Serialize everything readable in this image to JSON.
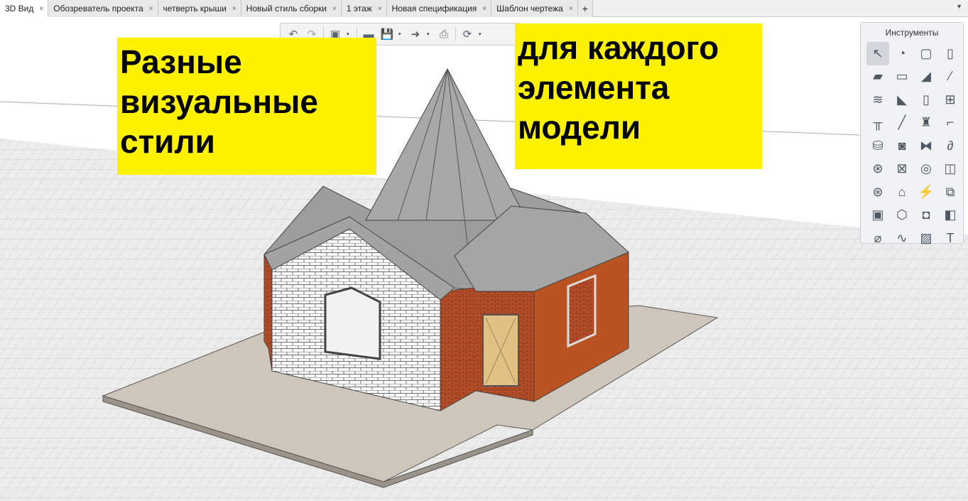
{
  "tabs": [
    {
      "label": "3D Вид",
      "active": true
    },
    {
      "label": "Обозреватель проекта"
    },
    {
      "label": "четверть крыши"
    },
    {
      "label": "Новый стиль сборки"
    },
    {
      "label": "1 этаж"
    },
    {
      "label": "Новая спецификация"
    },
    {
      "label": "Шаблон чертежа"
    }
  ],
  "tab_close": "×",
  "tab_add": "+",
  "tab_menu": "▼",
  "toolbar": {
    "undo": "↶",
    "redo": "↷",
    "view3d": "▣",
    "open": "▬",
    "save": "💾",
    "export": "➜",
    "print": "⎙",
    "orbit": "⟳",
    "dropdown": "▾"
  },
  "annotations": {
    "left": "Разные визуальные стили",
    "right": "для каждого элемента модели"
  },
  "tools_panel": {
    "title": "Инструменты",
    "items": [
      {
        "name": "select",
        "glyph": "↖"
      },
      {
        "name": "styles",
        "glyph": "◔"
      },
      {
        "name": "box",
        "glyph": "▢"
      },
      {
        "name": "column",
        "glyph": "▯"
      },
      {
        "name": "slab",
        "glyph": "▰"
      },
      {
        "name": "opening-slab",
        "glyph": "▭"
      },
      {
        "name": "roof",
        "glyph": "◢"
      },
      {
        "name": "beam",
        "glyph": "⁄"
      },
      {
        "name": "stairs",
        "glyph": "≋"
      },
      {
        "name": "ramp",
        "glyph": "◣"
      },
      {
        "name": "door",
        "glyph": "▯"
      },
      {
        "name": "window",
        "glyph": "⊞"
      },
      {
        "name": "railing",
        "glyph": "╥"
      },
      {
        "name": "line",
        "glyph": "╱"
      },
      {
        "name": "equipment",
        "glyph": "♜"
      },
      {
        "name": "duct",
        "glyph": "⌐"
      },
      {
        "name": "plumbing",
        "glyph": "⛁"
      },
      {
        "name": "washer",
        "glyph": "◙"
      },
      {
        "name": "valve",
        "glyph": "⧓"
      },
      {
        "name": "pipe",
        "glyph": "∂"
      },
      {
        "name": "water-system",
        "glyph": "⊛"
      },
      {
        "name": "fan",
        "glyph": "⊠"
      },
      {
        "name": "cable",
        "glyph": "◎"
      },
      {
        "name": "duct-fitting",
        "glyph": "◫"
      },
      {
        "name": "ventilation-system",
        "glyph": "⊛"
      },
      {
        "name": "lighting",
        "glyph": "⌂"
      },
      {
        "name": "electric-system",
        "glyph": "⚡"
      },
      {
        "name": "socket",
        "glyph": "⧉"
      },
      {
        "name": "panel",
        "glyph": "▣"
      },
      {
        "name": "mesh",
        "glyph": "⬡"
      },
      {
        "name": "device",
        "glyph": "◘"
      },
      {
        "name": "connector",
        "glyph": "◧"
      },
      {
        "name": "dimension",
        "glyph": "⌀"
      },
      {
        "name": "spline",
        "glyph": "∿"
      },
      {
        "name": "hatch",
        "glyph": "▨"
      },
      {
        "name": "text",
        "glyph": "T"
      }
    ]
  }
}
